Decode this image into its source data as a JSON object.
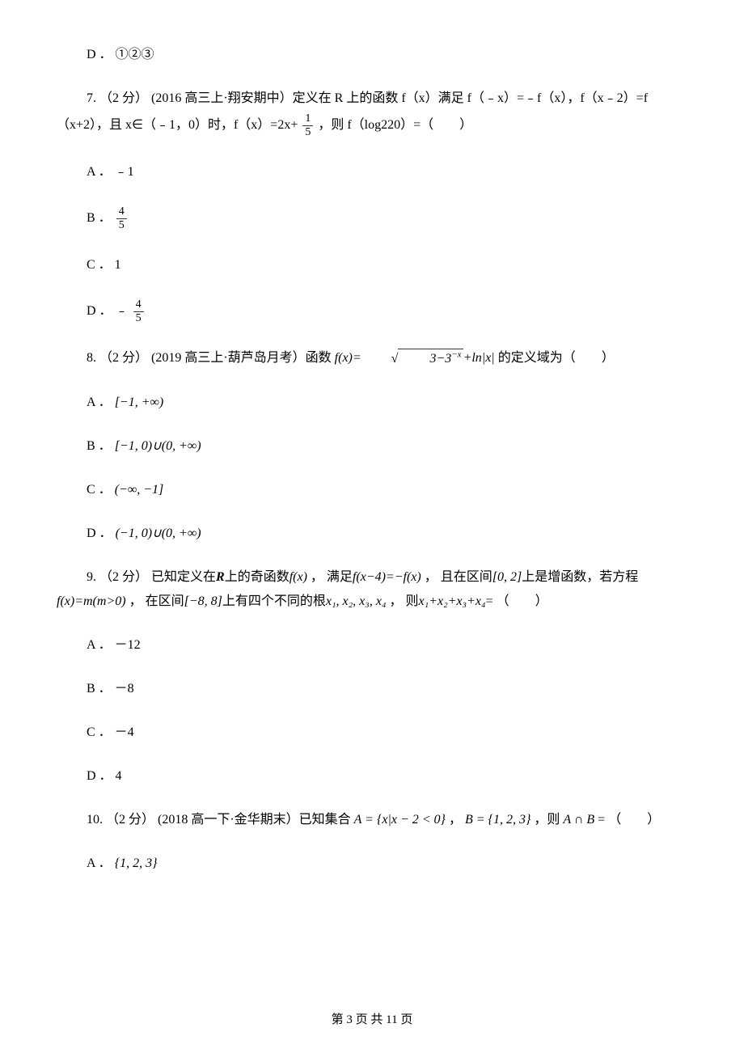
{
  "d_option": "D ． ①②③",
  "q7": {
    "line1": "7. （2 分） (2016 高三上·翔安期中）定义在 R 上的函数 f（x）满足 f（﹣x）=﹣f（x），f（x﹣2）=f",
    "line2_a": "（x+2），且 x∈（﹣1，0）时，f（x）=2x+ ",
    "line2_b": " ，则 f（log220）=（　　）",
    "frac_num": "1",
    "frac_den": "5",
    "a": "A ． ﹣1",
    "b_label": "B ． ",
    "b_num": "4",
    "b_den": "5",
    "c": "C ． 1",
    "d_label": "D ． ﹣ ",
    "d_num": "4",
    "d_den": "5"
  },
  "q8": {
    "line_a": "8. （2 分） (2019 高三上·葫芦岛月考）函数 ",
    "expr1": "f(x)=",
    "sqrt_inner": "3−3",
    "sqrt_exp": "−x",
    "plus": "+ln|x|",
    "line_b": " 的定义域为（　　）",
    "a_label": "A ． ",
    "a_expr": "[−1, +∞)",
    "b_label": "B ． ",
    "b_expr": "[−1, 0)∪(0, +∞)",
    "c_label": "C ． ",
    "c_expr": "(−∞, −1]",
    "d_label": "D ． ",
    "d_expr": "(−1, 0)∪(0, +∞)"
  },
  "q9": {
    "line1_a": "9. （2 分） 已知定义在",
    "R": "R",
    "line1_b": "上的奇函数",
    "fx": "f(x)",
    "line1_c": " ， 满足",
    "fxm4": "f(x−4)=−f(x)",
    "line1_d": " ， 且在区间",
    "int02": "[0, 2]",
    "line1_e": "上是增函数，若方程",
    "line2_a": "",
    "eq": "f(x)=m(m>0)",
    "line2_b": " ， 在区间",
    "int88": "[−8, 8]",
    "line2_c": "上有四个不同的根",
    "roots": "x₁, x₂, x₃, x₄",
    "line2_d": " ， 则",
    "sum": "x₁+x₂+x₃+x₄",
    "line2_e": "= （　　）",
    "a": "A ． －12",
    "b": "B ． －8",
    "c": "C ． －4",
    "d": "D ． 4"
  },
  "q10": {
    "line_a": "10. （2 分） (2018 高一下·金华期末）已知集合 ",
    "A_expr": "A = {x|x − 2 < 0}",
    "sep": " ， ",
    "B_expr": "B = {1, 2, 3}",
    "line_b": " ，则 ",
    "AB": "A ∩ B",
    "line_c": " = （　　）",
    "a_label": "A ． ",
    "a_expr": "{1, 2, 3}"
  },
  "footer": "第 3 页 共 11 页"
}
